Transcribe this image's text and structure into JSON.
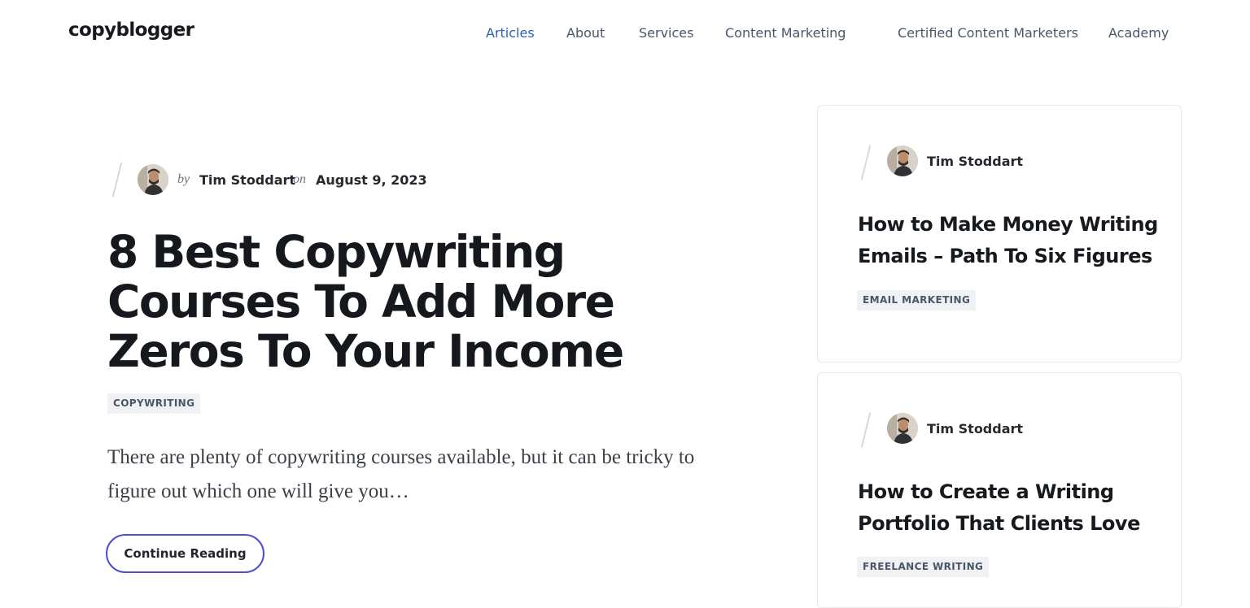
{
  "header": {
    "logo": "copyblogger",
    "nav": [
      {
        "label": "Articles",
        "active": true
      },
      {
        "label": "About",
        "active": false
      },
      {
        "label": "Services",
        "active": false
      },
      {
        "label": "Content Marketing",
        "active": false
      },
      {
        "label": "Certified Content Marketers",
        "active": false
      },
      {
        "label": "Academy",
        "active": false
      }
    ]
  },
  "featured": {
    "by": "by",
    "author": "Tim Stoddart",
    "on": "on",
    "date": "August 9, 2023",
    "title": "8 Best Copywriting Courses To Add More Zeros To Your Income",
    "category": "COPYWRITING",
    "excerpt": "There are plenty of copywriting courses available, but it can be tricky to figure out which one will give you…",
    "button": "Continue Reading"
  },
  "sidebar": {
    "cards": [
      {
        "author": "Tim Stoddart",
        "title": "How to Make Money Writing Emails – Path To Six Figures",
        "category": "EMAIL MARKETING"
      },
      {
        "author": "Tim Stoddart",
        "title": "How to Create a Writing Portfolio That Clients Love",
        "category": "FREELANCE WRITING"
      }
    ]
  },
  "colors": {
    "accent": "#2a63b8",
    "button_border": "#4d4ed3",
    "tag_bg": "#eff1f4"
  }
}
